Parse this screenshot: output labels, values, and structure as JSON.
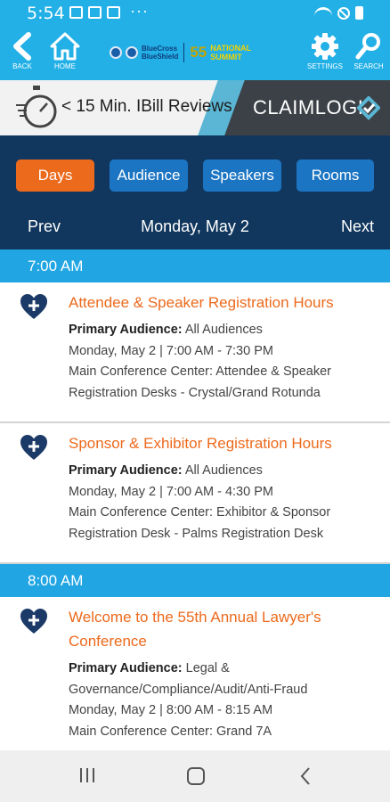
{
  "status_bar": {
    "time": "5:54",
    "more": "···"
  },
  "header": {
    "back_label": "BACK",
    "home_label": "HOME",
    "settings_label": "SETTINGS",
    "search_label": "SEARCH",
    "brand_bcbs_line1": "BlueCross",
    "brand_bcbs_line2": "BlueShield",
    "brand_number": "55",
    "brand_ns_line1": "NATIONAL",
    "brand_ns_line2": "SUMMIT"
  },
  "banner": {
    "tagline": "< 15 Min. IBill Reviews",
    "company": "CLAIMLOGI"
  },
  "tabs": [
    {
      "label": "Days",
      "active": true
    },
    {
      "label": "Audience",
      "active": false
    },
    {
      "label": "Speakers",
      "active": false
    },
    {
      "label": "Rooms",
      "active": false
    }
  ],
  "day_nav": {
    "prev": "Prev",
    "title": "Monday, May 2",
    "next": "Next"
  },
  "schedule": [
    {
      "time": "7:00 AM",
      "sessions": [
        {
          "title": "Attendee & Speaker Registration Hours",
          "audience_label": "Primary Audience:",
          "audience": "All Audiences",
          "when": "Monday, May 2 | 7:00 AM - 7:30 PM",
          "location": "Main Conference Center: Attendee & Speaker Registration Desks - Crystal/Grand Rotunda"
        },
        {
          "title": "Sponsor & Exhibitor Registration Hours",
          "audience_label": "Primary Audience:",
          "audience": "All Audiences",
          "when": "Monday, May 2 | 7:00 AM - 4:30 PM",
          "location": "Main Conference Center: Exhibitor & Sponsor Registration Desk - Palms Registration Desk"
        }
      ]
    },
    {
      "time": "8:00 AM",
      "sessions": [
        {
          "title": "Welcome to the 55th Annual Lawyer's Conference",
          "audience_label": "Primary Audience:",
          "audience": "Legal & Governance/Compliance/Audit/Anti-Fraud",
          "when": "Monday, May 2 | 8:00 AM - 8:15 AM",
          "location": "Main Conference Center: Grand 7A"
        }
      ]
    }
  ],
  "colors": {
    "header_blue": "#22b0e6",
    "panel_navy": "#11375e",
    "tab_blue": "#1c75c3",
    "tab_active_orange": "#ec6a1c",
    "time_header_blue": "#22a6e3",
    "title_orange": "#ec6a1c",
    "heart_navy": "#1b3a68"
  }
}
